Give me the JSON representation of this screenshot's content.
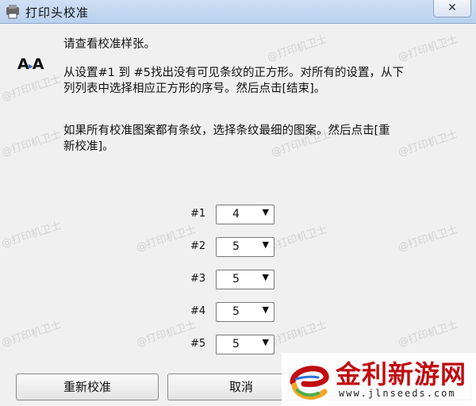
{
  "window": {
    "title": "打印头校准",
    "close_label": "✕"
  },
  "dialog": {
    "instruction_check": "请查看校准样张。",
    "aa_icon": {
      "left": "A",
      "arrow": "▸",
      "right": "A"
    },
    "paragraph_1_line_1": "从设置#1 到 #5找出没有可见条纹的正方形。对所有的设置，从下",
    "paragraph_1_line_2": "列列表中选择相应正方形的序号。然后点击[结束]。",
    "paragraph_2_line_1": "如果所有校准图案都有条纹，选择条纹最细的图案。然后点击[重",
    "paragraph_2_line_2": "新校准]。",
    "settings": [
      {
        "label": "#1",
        "value": "4"
      },
      {
        "label": "#2",
        "value": "5"
      },
      {
        "label": "#3",
        "value": "5"
      },
      {
        "label": "#4",
        "value": "5"
      },
      {
        "label": "#5",
        "value": "5"
      }
    ],
    "dropdown_arrow": "▼"
  },
  "buttons": {
    "recalibrate": "重新校准",
    "cancel": "取消"
  },
  "watermark_text": "@打印机卫士",
  "brand": {
    "name": "金利新游网",
    "url": "www.jlnseeds.com",
    "colors": {
      "red": "#c00c10",
      "orange": "#f5a623",
      "green": "#4caf50",
      "blue": "#2f6fd6"
    }
  }
}
